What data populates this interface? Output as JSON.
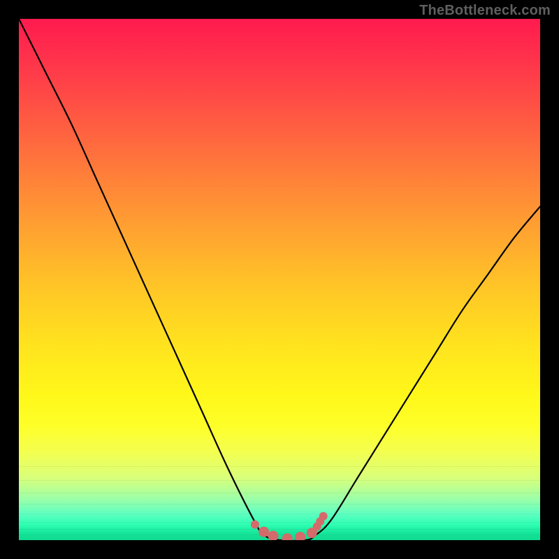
{
  "watermark": "TheBottleneck.com",
  "chart_data": {
    "type": "line",
    "title": "",
    "xlabel": "",
    "ylabel": "",
    "xlim": [
      0,
      100
    ],
    "ylim": [
      0,
      100
    ],
    "series": [
      {
        "name": "bottleneck-curve",
        "x": [
          0,
          5,
          10,
          15,
          20,
          25,
          30,
          35,
          40,
          45,
          47,
          50,
          55,
          57,
          60,
          65,
          70,
          75,
          80,
          85,
          90,
          95,
          100
        ],
        "values": [
          100,
          90,
          80,
          69,
          58,
          47,
          36,
          25,
          14,
          4,
          1,
          0,
          0,
          1,
          4,
          12,
          20,
          28,
          36,
          44,
          51,
          58,
          64
        ]
      }
    ],
    "markers": {
      "name": "highlight-dots",
      "color": "#d46a6a",
      "x": [
        45.3,
        47.0,
        48.8,
        51.5,
        54.0,
        56.2,
        57.2,
        57.8,
        58.4
      ],
      "y": [
        3.0,
        1.6,
        0.8,
        0.3,
        0.6,
        1.4,
        2.6,
        3.6,
        4.6
      ]
    },
    "gradient_stops": [
      {
        "pos": 0,
        "color": "#ff1a4e"
      },
      {
        "pos": 0.5,
        "color": "#ffc726"
      },
      {
        "pos": 0.78,
        "color": "#feff28"
      },
      {
        "pos": 1.0,
        "color": "#0fd98f"
      }
    ]
  }
}
